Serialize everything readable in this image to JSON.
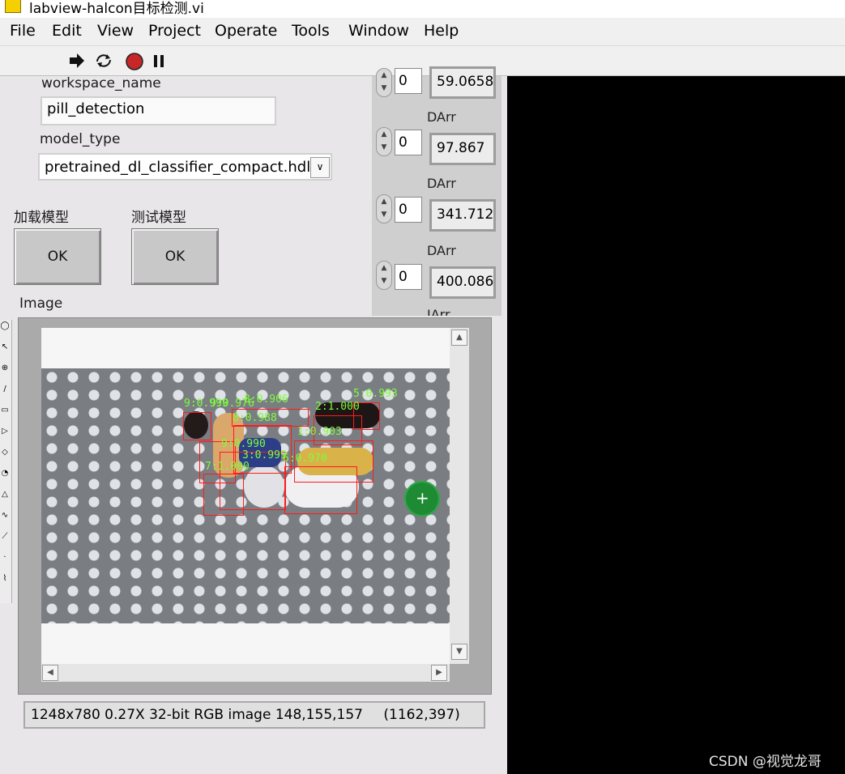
{
  "window": {
    "title": "labview-halcon目标检测.vi"
  },
  "menu": [
    "File",
    "Edit",
    "View",
    "Project",
    "Operate",
    "Tools",
    "Window",
    "Help"
  ],
  "toolbar": {
    "run": "run-arrow-icon",
    "run_continuous": "run-continuous-icon",
    "abort": "abort-icon",
    "pause": "pause-icon"
  },
  "controls": {
    "workspace_label": "workspace_name",
    "workspace_value": "pill_detection",
    "model_label": "model_type",
    "model_value": "pretrained_dl_classifier_compact.hdl",
    "load_label": "加载模型",
    "test_label": "测试模型",
    "ok_label": "OK",
    "image_label": "Image"
  },
  "arrays": [
    {
      "index": "0",
      "value": "59.0658",
      "label": "DArr"
    },
    {
      "index": "0",
      "value": "97.867",
      "label": "DArr"
    },
    {
      "index": "0",
      "value": "341.712",
      "label": "DArr"
    },
    {
      "index": "0",
      "value": "400.086",
      "label": "IArr"
    }
  ],
  "detections": [
    "9:0.999",
    "9:0.976",
    "8:0.906",
    "8:0.988",
    "2:1.000",
    "5:0.993",
    "1:0.903",
    "9:0.990",
    "3:0.999",
    "6:0.970",
    "7:1.000"
  ],
  "status": {
    "text": "1248x780 0.27X 32-bit RGB image 148,155,157",
    "coords": "(1162,397)"
  },
  "watermark": "CSDN @视觉龙哥",
  "colors": {
    "detection_box": "#ff1a1a",
    "detection_label": "#7dff3a",
    "cursor": "#1f8a34"
  }
}
